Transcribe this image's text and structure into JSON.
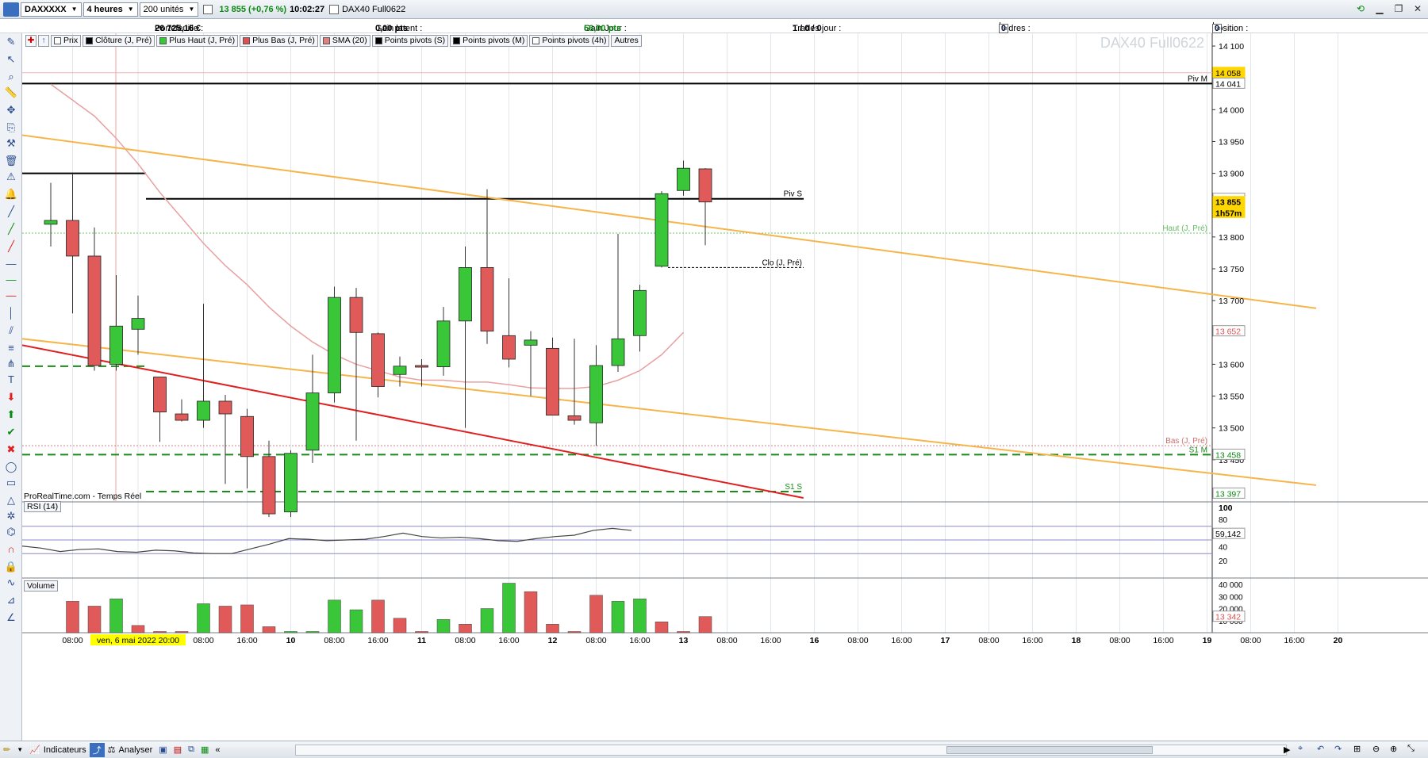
{
  "toolbar": {
    "instrument": "DAXXXXX",
    "timeframe": "4 heures",
    "units": "200 unités",
    "quote": "13 855 (+0,76 %)",
    "time": "10:02:27",
    "product": "DAX40 Full0622"
  },
  "status": {
    "portfolio_label": "Portefeuille :",
    "portfolio_value": "26 725,16 €",
    "latent_label": "Gain latent :",
    "latent_value": "0,00 pts",
    "day_label": "Gain Jour :",
    "day_value": "56,00 pts",
    "trades_label": "Trades jour :",
    "trades_value": "1 / 0 / 0",
    "orders_label": "Ordres :",
    "orders_value": "0",
    "orders_value2": "0",
    "position_label": "Position :",
    "position_value": "0",
    "position_value2": "0"
  },
  "legend": [
    {
      "label": "Prix",
      "color": "#ffffff"
    },
    {
      "label": "Clôture (J, Pré)",
      "color": "#000000"
    },
    {
      "label": "Plus Haut (J, Pré)",
      "color": "#33cc33"
    },
    {
      "label": "Plus Bas (J, Pré)",
      "color": "#e05050"
    },
    {
      "label": "SMA (20)",
      "color": "#e08080"
    },
    {
      "label": "Points pivots (S)",
      "color": "#000000"
    },
    {
      "label": "Points pivots (M)",
      "color": "#000000"
    },
    {
      "label": "Points pivots (4h)",
      "color": "#ffffff"
    },
    {
      "label": "Autres",
      "color": ""
    }
  ],
  "watermark": "DAX40 Full0622",
  "source": "ProRealTime.com - Temps Réel",
  "rsi_label": "RSI (14)",
  "volume_label": "Volume",
  "chart_data": {
    "type": "candlestick",
    "price_axis": {
      "ylim": [
        13385,
        14120
      ],
      "ticks": [
        "14 100",
        "14 050",
        "14 000",
        "13 950",
        "13 900",
        "13 850",
        "13 800",
        "13 750",
        "13 700",
        "13 650",
        "13 600",
        "13 550",
        "13 500",
        "13 450",
        "13 400"
      ]
    },
    "price_tags": [
      {
        "text": "14 058",
        "value": 14058,
        "bg": "#ffd700",
        "fg": "#000"
      },
      {
        "text": "14 041",
        "value": 14041,
        "bg": "#ffffff",
        "fg": "#000"
      },
      {
        "text": "13 860",
        "value": 13860,
        "bg": "#ffffff",
        "fg": "#000"
      },
      {
        "text": "13 855",
        "value": 13855,
        "bg": "#ffd700",
        "fg": "#000",
        "bold": true
      },
      {
        "text": "1h57m",
        "value": 13838,
        "bg": "#ffd700",
        "fg": "#000",
        "bold": true
      },
      {
        "text": "13 652",
        "value": 13652,
        "bg": "#ffffff",
        "fg": "#e05050"
      },
      {
        "text": "13 458",
        "value": 13458,
        "bg": "#ffffff",
        "fg": "#0a8a12"
      },
      {
        "text": "13 397",
        "value": 13397,
        "bg": "#ffffff",
        "fg": "#0a8a12"
      }
    ],
    "level_labels": [
      {
        "text": "Piv M",
        "value": 14041
      },
      {
        "text": "Piv S",
        "value": 13860
      },
      {
        "text": "Clo (J, Pré)",
        "value": 13752
      },
      {
        "text": "Haut (J, Pré)",
        "value": 13806
      },
      {
        "text": "Bas (J, Pré)",
        "value": 13472
      },
      {
        "text": "S1 M",
        "value": 13458
      },
      {
        "text": "S1 S",
        "value": 13400
      }
    ],
    "x_labels": [
      {
        "text": "08:00",
        "i": 1
      },
      {
        "text": "ven, 6 mai 2022 20:00",
        "i": 4,
        "highlight": true
      },
      {
        "text": "08:00",
        "i": 7
      },
      {
        "text": "16:00",
        "i": 9
      },
      {
        "text": "10",
        "i": 11,
        "bold": true
      },
      {
        "text": "08:00",
        "i": 13
      },
      {
        "text": "16:00",
        "i": 15
      },
      {
        "text": "11",
        "i": 17,
        "bold": true
      },
      {
        "text": "08:00",
        "i": 19
      },
      {
        "text": "16:00",
        "i": 21
      },
      {
        "text": "12",
        "i": 23,
        "bold": true
      },
      {
        "text": "08:00",
        "i": 25
      },
      {
        "text": "16:00",
        "i": 27
      },
      {
        "text": "13",
        "i": 29,
        "bold": true
      },
      {
        "text": "08:00",
        "i": 31
      },
      {
        "text": "16:00",
        "i": 33
      },
      {
        "text": "16",
        "i": 35,
        "bold": true
      },
      {
        "text": "08:00",
        "i": 37
      },
      {
        "text": "16:00",
        "i": 39
      },
      {
        "text": "17",
        "i": 41,
        "bold": true
      },
      {
        "text": "08:00",
        "i": 43
      },
      {
        "text": "16:00",
        "i": 45
      },
      {
        "text": "18",
        "i": 47,
        "bold": true
      },
      {
        "text": "08:00",
        "i": 49
      },
      {
        "text": "16:00",
        "i": 51
      },
      {
        "text": "19",
        "i": 53,
        "bold": true
      },
      {
        "text": "08:00",
        "i": 55
      },
      {
        "text": "16:00",
        "i": 57
      },
      {
        "text": "20",
        "i": 59,
        "bold": true
      }
    ],
    "candles": [
      {
        "o": 13820,
        "h": 13885,
        "l": 13785,
        "c": 13826
      },
      {
        "o": 13826,
        "h": 13900,
        "l": 13680,
        "c": 13770
      },
      {
        "o": 13770,
        "h": 13815,
        "l": 13590,
        "c": 13598
      },
      {
        "o": 13600,
        "h": 13740,
        "l": 13590,
        "c": 13660
      },
      {
        "o": 13655,
        "h": 13708,
        "l": 13615,
        "c": 13672
      },
      {
        "o": 13580,
        "h": 13580,
        "l": 13478,
        "c": 13525
      },
      {
        "o": 13522,
        "h": 13545,
        "l": 13510,
        "c": 13512
      },
      {
        "o": 13512,
        "h": 13695,
        "l": 13500,
        "c": 13542
      },
      {
        "o": 13542,
        "h": 13552,
        "l": 13412,
        "c": 13522
      },
      {
        "o": 13518,
        "h": 13530,
        "l": 13405,
        "c": 13455
      },
      {
        "o": 13455,
        "h": 13480,
        "l": 13360,
        "c": 13365
      },
      {
        "o": 13368,
        "h": 13465,
        "l": 13360,
        "c": 13460
      },
      {
        "o": 13465,
        "h": 13615,
        "l": 13445,
        "c": 13555
      },
      {
        "o": 13555,
        "h": 13722,
        "l": 13540,
        "c": 13705
      },
      {
        "o": 13705,
        "h": 13720,
        "l": 13480,
        "c": 13650
      },
      {
        "o": 13648,
        "h": 13650,
        "l": 13548,
        "c": 13565
      },
      {
        "o": 13584,
        "h": 13612,
        "l": 13565,
        "c": 13597
      },
      {
        "o": 13598,
        "h": 13608,
        "l": 13565,
        "c": 13596
      },
      {
        "o": 13596,
        "h": 13690,
        "l": 13582,
        "c": 13668
      },
      {
        "o": 13668,
        "h": 13785,
        "l": 13500,
        "c": 13752
      },
      {
        "o": 13752,
        "h": 13875,
        "l": 13632,
        "c": 13652
      },
      {
        "o": 13645,
        "h": 13735,
        "l": 13595,
        "c": 13608
      },
      {
        "o": 13630,
        "h": 13652,
        "l": 13550,
        "c": 13638
      },
      {
        "o": 13625,
        "h": 13642,
        "l": 13530,
        "c": 13520
      },
      {
        "o": 13519,
        "h": 13640,
        "l": 13505,
        "c": 13512
      },
      {
        "o": 13508,
        "h": 13630,
        "l": 13472,
        "c": 13598
      },
      {
        "o": 13598,
        "h": 13805,
        "l": 13588,
        "c": 13640
      },
      {
        "o": 13645,
        "h": 13725,
        "l": 13620,
        "c": 13716
      },
      {
        "o": 13754,
        "h": 13872,
        "l": 13752,
        "c": 13868
      },
      {
        "o": 13873,
        "h": 13920,
        "l": 13865,
        "c": 13908
      },
      {
        "o": 13907,
        "h": 13908,
        "l": 13787,
        "c": 13855
      }
    ],
    "sma": [
      14040,
      14015,
      13990,
      13955,
      13915,
      13870,
      13830,
      13790,
      13755,
      13725,
      13690,
      13660,
      13635,
      13615,
      13600,
      13590,
      13580,
      13575,
      13575,
      13572,
      13572,
      13568,
      13563,
      13562,
      13562,
      13565,
      13575,
      13590,
      13615,
      13650
    ],
    "rsi": {
      "ylim": [
        0,
        100
      ],
      "ticks": [
        "80",
        "60",
        "40",
        "20"
      ],
      "top_label": "100",
      "current": "59,142",
      "values": [
        41,
        38,
        33,
        36,
        37,
        33,
        32,
        35,
        34,
        31,
        30,
        30,
        37,
        44,
        52,
        51,
        49,
        50,
        51,
        55,
        60,
        55,
        53,
        54,
        52,
        49,
        48,
        52,
        55,
        57,
        64,
        67,
        64
      ],
      "bands": [
        70,
        50,
        30
      ]
    },
    "volume": {
      "ylim": [
        0,
        42000
      ],
      "ticks": [
        "40 000",
        "30 000",
        "20 000",
        "10 000"
      ],
      "current": "13 342",
      "values": [
        26000,
        22000,
        28000,
        6000,
        1000,
        1000,
        24000,
        22000,
        23000,
        5000,
        1000,
        1000,
        27000,
        19000,
        27000,
        12000,
        1000,
        11000,
        7000,
        20000,
        41000,
        34000,
        7000,
        1000,
        31000,
        26000,
        28000,
        9000,
        1000,
        13342
      ]
    },
    "lines": [
      {
        "name": "orange-upper",
        "color": "#f5b54a",
        "points": [
          [
            0,
            13960
          ],
          [
            58,
            13688
          ]
        ]
      },
      {
        "name": "orange-lower",
        "color": "#f5b54a",
        "points": [
          [
            0,
            13640
          ],
          [
            58,
            13410
          ]
        ]
      },
      {
        "name": "red-trend",
        "color": "#e02020",
        "points": [
          [
            0,
            13630
          ],
          [
            34.5,
            13390
          ]
        ]
      }
    ]
  },
  "bottombar": {
    "indicators": "Indicateurs",
    "analyze": "Analyser"
  }
}
